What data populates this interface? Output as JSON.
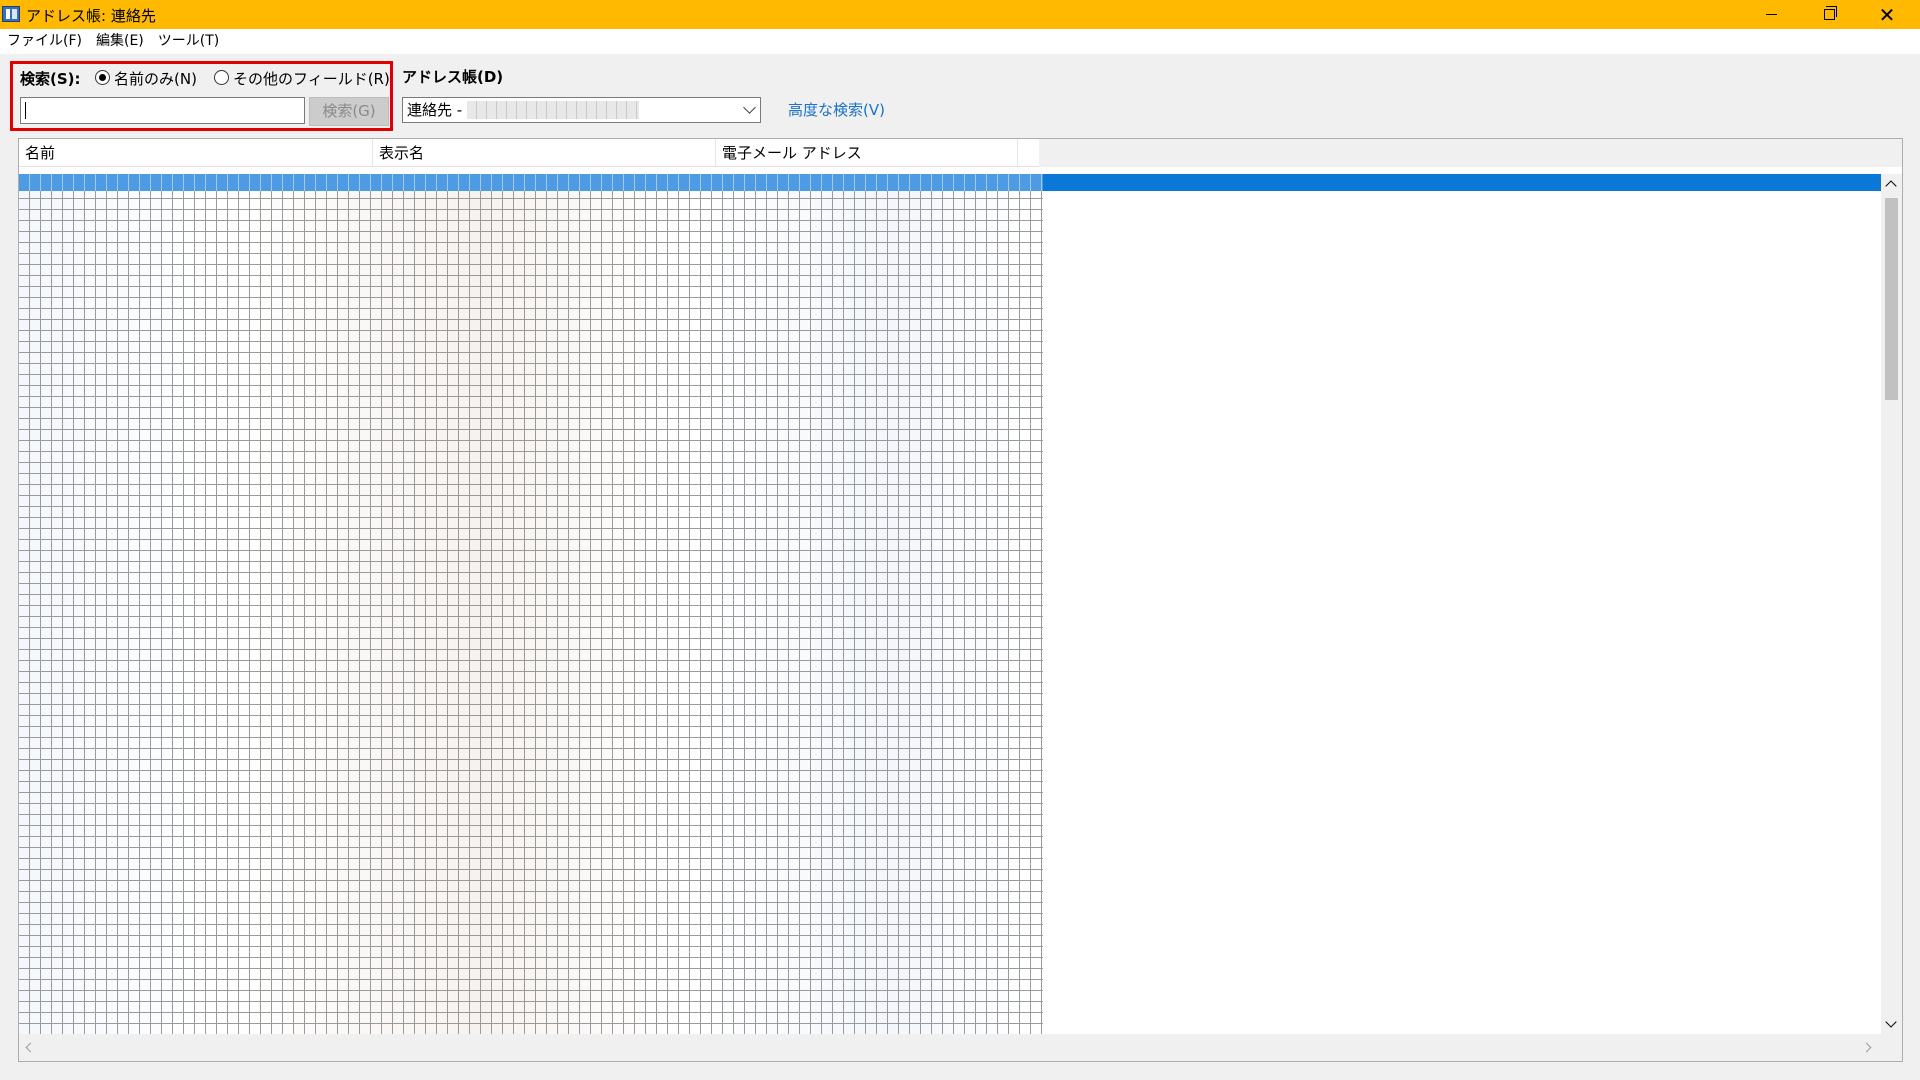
{
  "window": {
    "title": "アドレス帳: 連絡先",
    "app_icon": "address-book-icon",
    "controls": {
      "minimize_icon": "minimize-icon",
      "restore_icon": "restore-icon",
      "close_icon": "close-icon",
      "close_glyph": "✕"
    }
  },
  "menu": {
    "items": [
      {
        "label": "ファイル(F)"
      },
      {
        "label": "編集(E)"
      },
      {
        "label": "ツール(T)"
      }
    ]
  },
  "search": {
    "label": "検索(S):",
    "options": [
      {
        "label": "名前のみ(N)",
        "checked": true
      },
      {
        "label": "その他のフィールド(R)",
        "checked": false
      }
    ],
    "input_value": "",
    "button_label": "検索(G)",
    "button_enabled": false,
    "highlight_color": "#e00000"
  },
  "address_book": {
    "label": "アドレス帳(D)",
    "selected": "連絡先 -",
    "advanced_link": "高度な検索(V)"
  },
  "list": {
    "columns": [
      {
        "label": "名前"
      },
      {
        "label": "表示名"
      },
      {
        "label": "電子メール アドレス"
      }
    ],
    "selection_color": "#0a78d7"
  },
  "colors": {
    "titlebar": "#ffb900",
    "link": "#1a73c8"
  }
}
